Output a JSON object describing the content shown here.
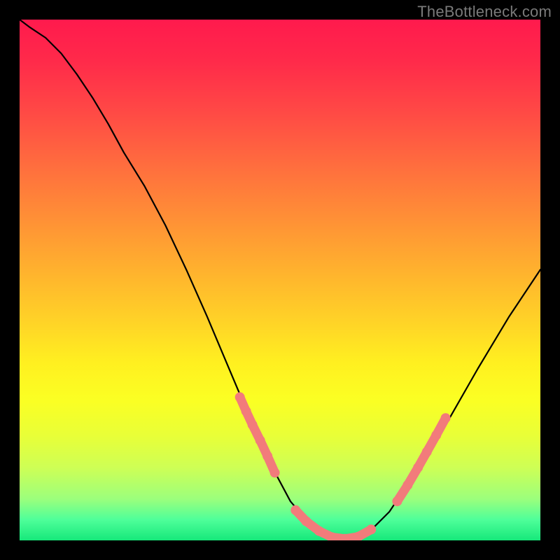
{
  "attribution": "TheBottleneck.com",
  "colors": {
    "frame": "#000000",
    "curve": "#000000",
    "marker_fill": "#f27b7b",
    "marker_stroke": "#e86c6c",
    "gradient_top": "#ff1a4d",
    "gradient_bottom": "#16e87a"
  },
  "chart_data": {
    "type": "line",
    "title": "",
    "xlabel": "",
    "ylabel": "",
    "xlim": [
      0,
      1
    ],
    "ylim": [
      0,
      1
    ],
    "grid": false,
    "legend": false,
    "series": [
      {
        "name": "curve",
        "x": [
          0.0,
          0.02,
          0.05,
          0.08,
          0.11,
          0.14,
          0.17,
          0.2,
          0.24,
          0.28,
          0.32,
          0.36,
          0.4,
          0.44,
          0.48,
          0.52,
          0.56,
          0.6,
          0.64,
          0.67,
          0.71,
          0.76,
          0.82,
          0.88,
          0.94,
          1.0
        ],
        "y": [
          1.0,
          0.985,
          0.965,
          0.935,
          0.895,
          0.85,
          0.8,
          0.745,
          0.68,
          0.605,
          0.52,
          0.43,
          0.335,
          0.24,
          0.15,
          0.075,
          0.028,
          0.005,
          0.003,
          0.015,
          0.055,
          0.13,
          0.225,
          0.33,
          0.43,
          0.52
        ]
      }
    ],
    "markers": {
      "name": "highlight-segments",
      "color": "#f27b7b",
      "segments": [
        {
          "x": [
            0.423,
            0.435,
            0.447,
            0.462,
            0.476,
            0.49
          ],
          "y": [
            0.275,
            0.248,
            0.222,
            0.192,
            0.162,
            0.13
          ]
        },
        {
          "x": [
            0.53,
            0.55,
            0.575,
            0.6,
            0.625,
            0.65,
            0.675
          ],
          "y": [
            0.058,
            0.037,
            0.018,
            0.006,
            0.003,
            0.007,
            0.021
          ]
        },
        {
          "x": [
            0.725,
            0.745,
            0.765,
            0.782,
            0.8,
            0.818
          ],
          "y": [
            0.075,
            0.106,
            0.14,
            0.17,
            0.202,
            0.235
          ]
        }
      ]
    }
  }
}
